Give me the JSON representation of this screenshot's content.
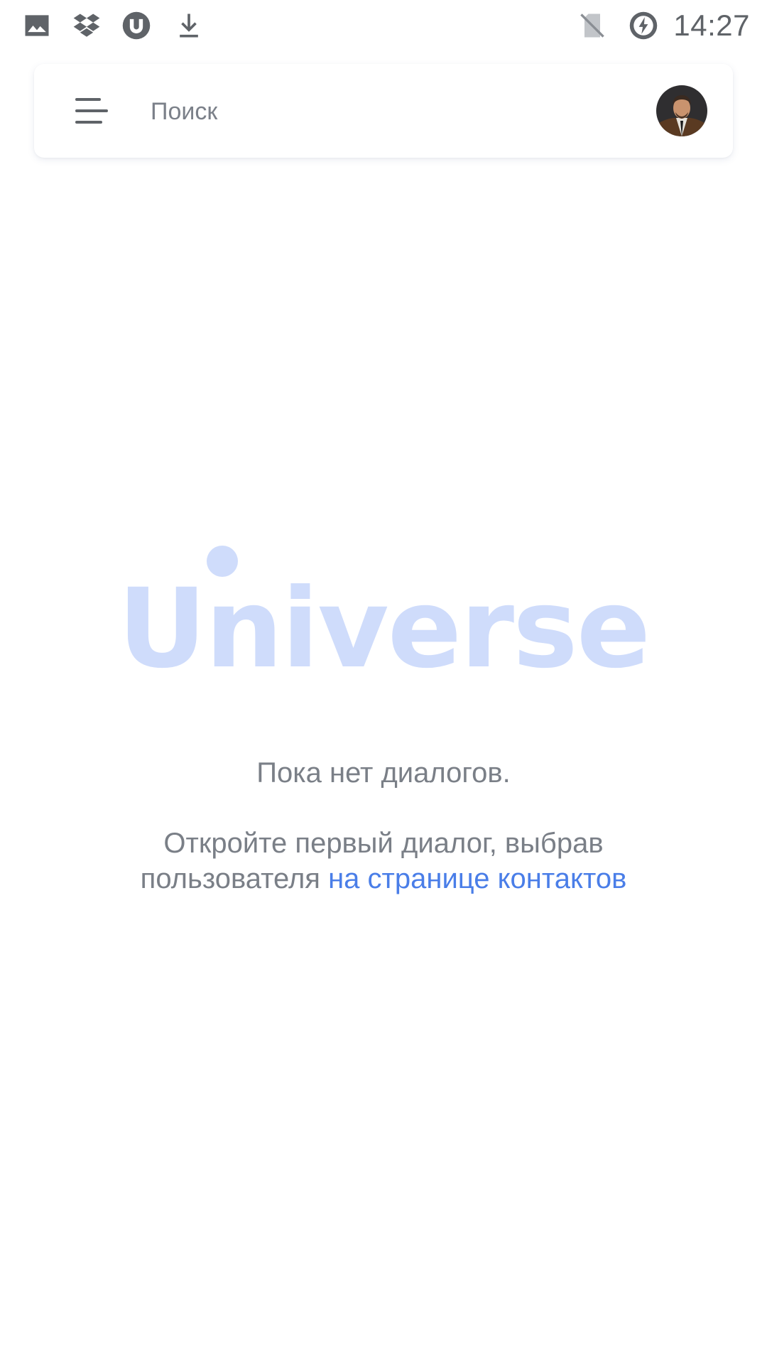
{
  "status_bar": {
    "time": "14:27",
    "icons": [
      "gallery-icon",
      "dropbox-icon",
      "utorrent-icon",
      "download-icon",
      "no-sim-icon",
      "battery-saver-icon"
    ]
  },
  "search": {
    "placeholder": "Поиск"
  },
  "logo": {
    "text": "Universe",
    "color": "#cfdcfb"
  },
  "empty_state": {
    "title": "Пока нет диалогов.",
    "description": "Откройте первый диалог, выбрав пользователя",
    "link": "на странице контактов"
  },
  "colors": {
    "link": "#4a7ee8",
    "muted_text": "#7a7f87",
    "icon_gray": "#5f6368"
  }
}
